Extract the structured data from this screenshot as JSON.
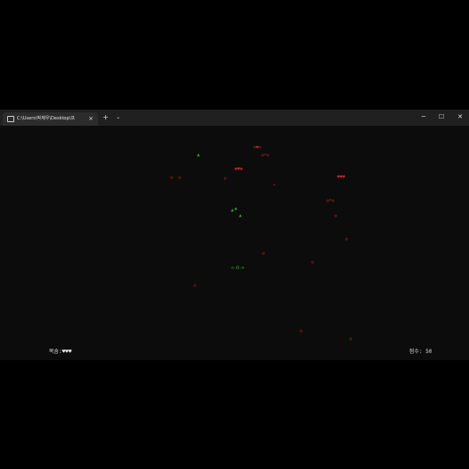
{
  "window": {
    "tab_title": "C:\\Users\\박재우\\Desktop\\프",
    "tab_close": "×",
    "new_tab": "+",
    "tab_menu": "⌄",
    "minimize": "─",
    "maximize": "☐",
    "close": "✕",
    "icons": {
      "tab": "terminal-icon",
      "new_tab": "plus-icon",
      "tab_menu": "chevron-down-icon",
      "minimize": "minimize-icon",
      "maximize": "maximize-icon",
      "close": "close-icon"
    }
  },
  "game": {
    "enemies": [
      "☺♥☺",
      "☺*☺",
      "☻♥☻",
      "☺  ☺",
      "☺",
      "♥♥♥",
      "*",
      "☺*☺",
      "☺",
      "☺",
      "☺",
      "☺",
      "☺",
      "Y",
      "☺",
      "☺"
    ],
    "bullets": [
      "▲",
      "▲",
      "▲",
      "▲"
    ],
    "player": "<-O->",
    "lives_label": "목숨:",
    "lives_hearts": "♥♥♥",
    "score_label": "점수:",
    "score_value": "50"
  },
  "colors": {
    "background": "#0c0c0c",
    "titlebar": "#202020",
    "enemy": "#d02828",
    "bullet": "#2fb432",
    "player": "#36c23a",
    "hud_text": "#d8d8d8"
  }
}
